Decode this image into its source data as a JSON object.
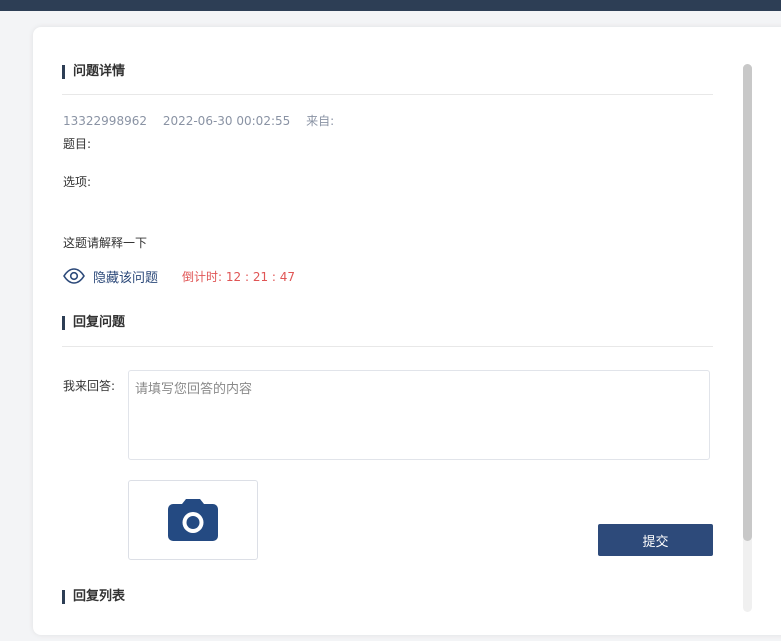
{
  "colors": {
    "accent": "#2d4a7a",
    "header_bar": "#2d3e55",
    "countdown": "#e05555",
    "meta_text": "#8a93a4"
  },
  "question_detail": {
    "title": "问题详情",
    "phone": "13322998962",
    "datetime": "2022-06-30 00:02:55",
    "from_label": "来自:",
    "subject_label": "题目:",
    "options_label": "选项:",
    "content": "这题请解释一下",
    "hide_icon": "eye-icon",
    "hide_label": "隐藏该问题",
    "countdown": "倒计时:  12 :  21 :  47"
  },
  "reply_section": {
    "title": "回复问题",
    "answer_label": "我来回答:",
    "answer_placeholder": "请填写您回答的内容",
    "answer_value": "",
    "upload_icon": "camera-icon",
    "submit_label": "提交"
  },
  "reply_list": {
    "title": "回复列表"
  }
}
